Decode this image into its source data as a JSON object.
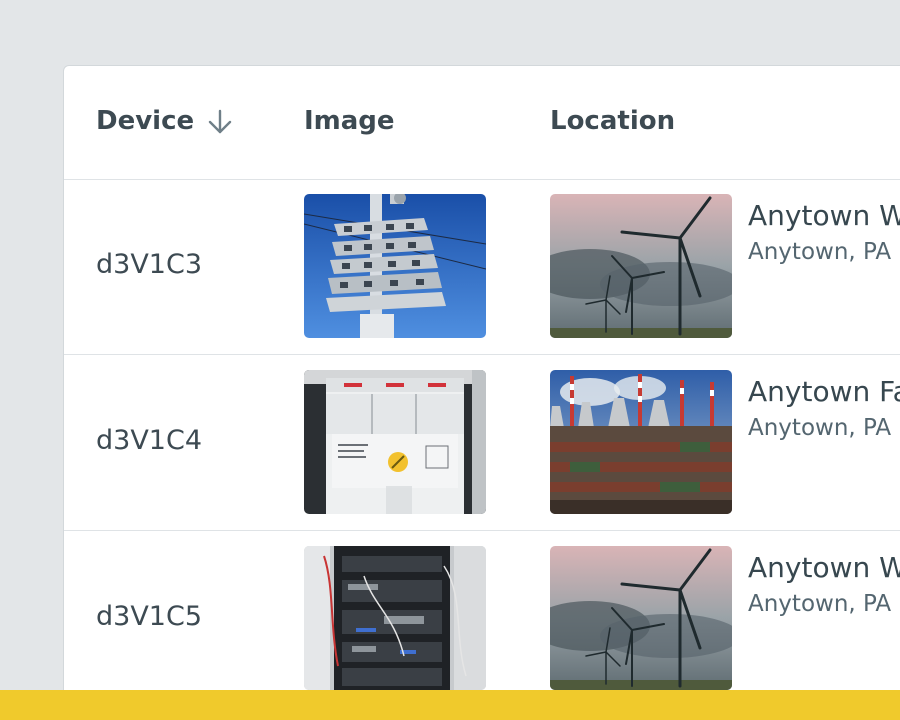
{
  "table": {
    "headers": {
      "device": "Device",
      "image": "Image",
      "location": "Location"
    },
    "sort": {
      "column": "device",
      "direction": "descending",
      "icon": "arrow-down-icon"
    },
    "rows": [
      {
        "device": "d3V1C3",
        "image_subject": "electrical meters on pole",
        "location_name": "Anytown Wi",
        "location_city": "Anytown, PA",
        "location_image": "wind turbines"
      },
      {
        "device": "d3V1C4",
        "image_subject": "circuit breaker",
        "location_name": "Anytown Fa",
        "location_city": "Anytown, PA",
        "location_image": "factory with cooling towers"
      },
      {
        "device": "d3V1C5",
        "image_subject": "server rack",
        "location_name": "Anytown Wi",
        "location_city": "Anytown, PA",
        "location_image": "wind turbines"
      }
    ]
  },
  "colors": {
    "background": "#e3e6e8",
    "card": "#ffffff",
    "bottom_bar": "#f0ca2c",
    "text_primary": "#3d4a52",
    "text_secondary": "#546670"
  }
}
